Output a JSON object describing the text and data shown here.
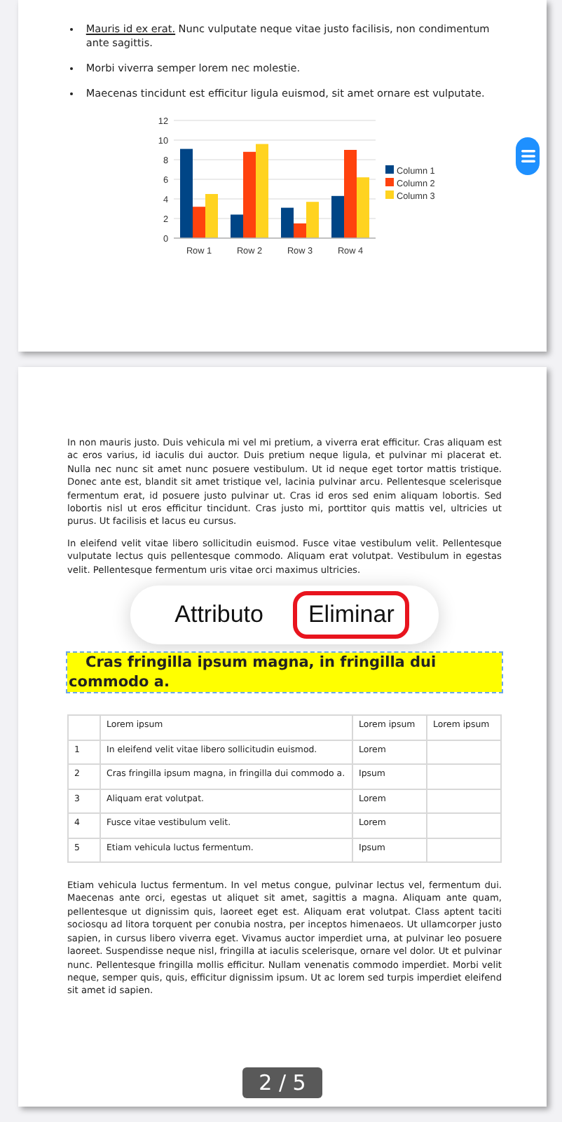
{
  "pages": [
    {
      "bullets": [
        {
          "link": "Mauris id ex erat.",
          "text": "Nunc vulputate neque vitae justo facilisis, non condimentum ante sagittis."
        },
        {
          "text": "Morbi viverra semper lorem nec molestie."
        },
        {
          "text": "Maecenas tincidunt est efficitur ligula euismod, sit amet ornare est vulputate."
        }
      ],
      "chart_data": {
        "type": "bar",
        "categories": [
          "Row 1",
          "Row 2",
          "Row 3",
          "Row 4"
        ],
        "series": [
          {
            "name": "Column 1",
            "color": "#004586",
            "values": [
              9.1,
              2.4,
              3.1,
              4.3
            ]
          },
          {
            "name": "Column 2",
            "color": "#ff420e",
            "values": [
              3.2,
              8.8,
              1.5,
              9.0
            ]
          },
          {
            "name": "Column 3",
            "color": "#ffd320",
            "values": [
              4.5,
              9.6,
              3.7,
              6.2
            ]
          }
        ],
        "ylim": [
          0,
          12
        ],
        "yticks": [
          0,
          2,
          4,
          6,
          8,
          10,
          12
        ],
        "grid": true,
        "legend": true
      }
    },
    {
      "paragraphs": [
        "In non mauris justo. Duis vehicula mi vel mi pretium, a viverra erat efficitur. Cras aliquam est ac eros varius, id iaculis dui auctor. Duis pretium neque ligula, et pulvinar mi placerat et. Nulla nec nunc sit amet nunc posuere vestibulum. Ut id neque eget tortor mattis tristique. Donec ante est, blandit sit amet tristique vel, lacinia pulvinar arcu. Pellentesque scelerisque fermentum erat, id posuere justo pulvinar ut. Cras id eros sed enim aliquam lobortis. Sed lobortis nisl ut eros efficitur tincidunt. Cras justo mi, porttitor quis mattis vel, ultricies ut purus. Ut facilisis et lacus eu cursus.",
        "In eleifend velit vitae libero sollicitudin euismod. Fusce vitae vestibulum velit. Pellentesque vulputate lectus quis pellentesque commodo. Aliquam erat volutpat. Vestibulum in egestas velit. Pellentesque fermentum uris vitae orci maximus ultricies."
      ],
      "popup": [
        {
          "label": "Attributo",
          "selected": false
        },
        {
          "label": "Eliminar",
          "selected": true
        }
      ],
      "heading": {
        "text": "Cras fringilla ipsum magna, in fringilla dui commodo a.",
        "selected": true
      },
      "table": {
        "columns": [
          "Lorem ipsum",
          "Lorem ipsum",
          "Lorem ipsum"
        ],
        "rows": [
          {
            "number": "1",
            "text": "In eleifend velit vitae libero sollicitudin euismod.",
            "value": "Lorem"
          },
          {
            "number": "2",
            "text": "Cras fringilla ipsum magna, in fringilla dui commodo a.",
            "value": "Ipsum"
          },
          {
            "number": "3",
            "text": "Aliquam erat volutpat.",
            "value": "Lorem"
          },
          {
            "number": "4",
            "text": "Fusce vitae vestibulum velit.",
            "value": "Lorem"
          },
          {
            "number": "5",
            "text": "Etiam vehicula luctus fermentum.",
            "value": "Ipsum"
          }
        ]
      },
      "closing": "Etiam vehicula luctus fermentum. In vel metus congue, pulvinar lectus vel, fermentum dui. Maecenas ante orci, egestas ut aliquet sit amet, sagittis a magna. Aliquam ante quam, pellentesque ut dignissim quis, laoreet eget est. Aliquam erat volutpat. Class aptent taciti sociosqu ad litora torquent per conubia nostra, per inceptos himenaeos. Ut ullamcorper justo sapien, in cursus libero viverra eget. Vivamus auctor imperdiet urna, at pulvinar leo posuere laoreet. Suspendisse neque nisl, fringilla at iaculis scelerisque, ornare vel dolor. Ut et pulvinar nunc. Pellentesque fringilla mollis efficitur. Nullam venenatis commodo imperdiet. Morbi velit neque, semper quis, quis, efficitur dignissim ipsum. Ut ac lorem sed turpis imperdiet eleifend sit amet id sapien."
    }
  ],
  "page_indicator": "2 / 5"
}
